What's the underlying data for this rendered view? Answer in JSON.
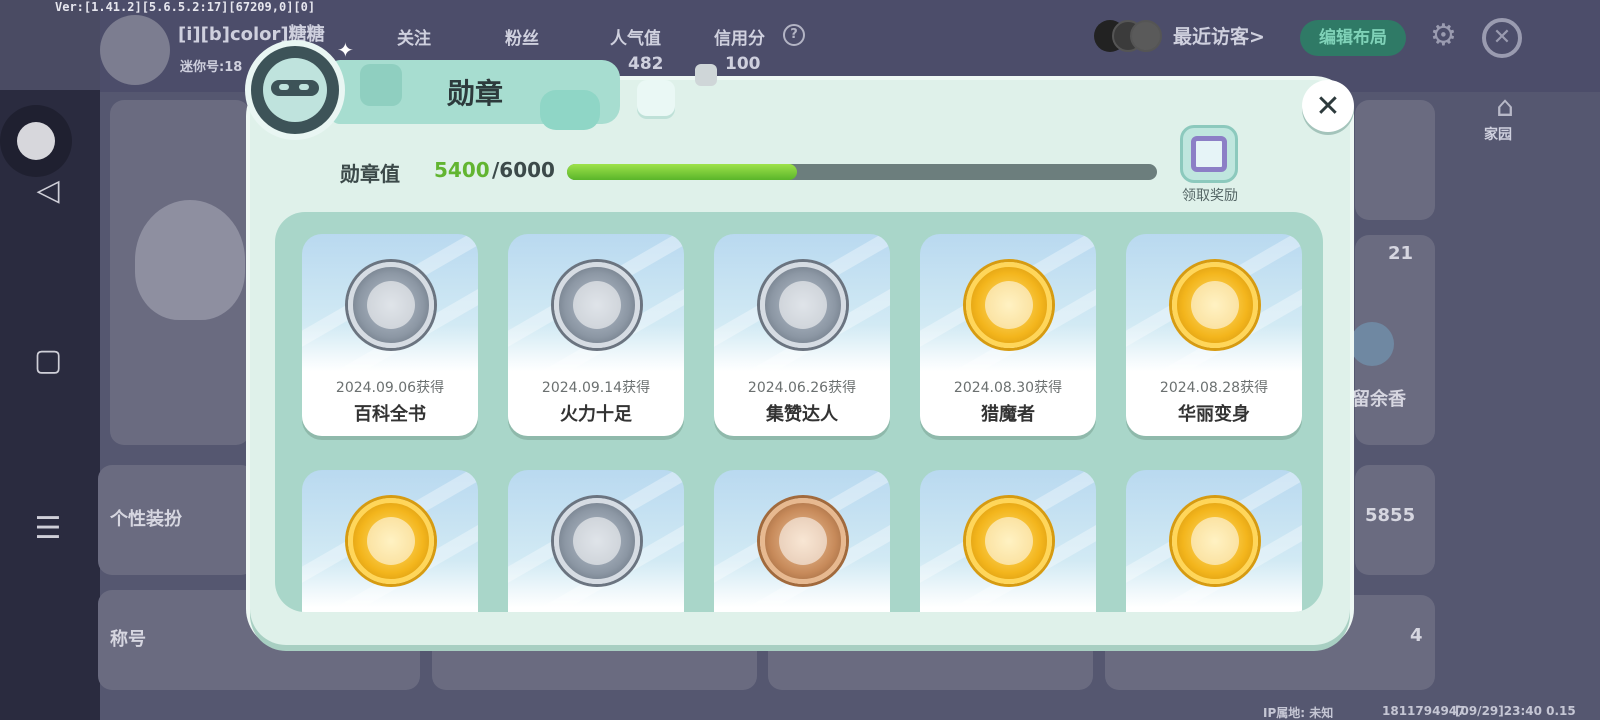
{
  "version_text": "Ver:[1.41.2][5.6.5.2:17][67209,0][0]",
  "profile": {
    "name": "[i][b]color]糖糖",
    "mini_id": "迷你号:18",
    "stats": [
      {
        "label": "关注",
        "value": ""
      },
      {
        "label": "粉丝",
        "value": ""
      },
      {
        "label": "人气值",
        "value": "482"
      },
      {
        "label": "信用分",
        "value": "100"
      }
    ],
    "help_icon": "question-icon"
  },
  "header_right": {
    "recent_visitors": "最近访客>",
    "edit_layout": "编辑布局",
    "home_label": "家园"
  },
  "background": {
    "count_21": "21",
    "count_5855": "5855",
    "count_4": "4",
    "personal_dress": "个性装扮",
    "title_label": "称号",
    "lingering_text": "留余香",
    "footer_id": "1811794947",
    "footer_time": "[09/29]23:40 0.15",
    "footer_left": "IP属地: 未知"
  },
  "dialog": {
    "title": "勋章",
    "meter_label": "勋章值",
    "meter_current": "5400",
    "meter_max": "/6000",
    "meter_progress": 0.39,
    "reward_label": "领取奖励",
    "close_icon": "close-icon"
  },
  "badges": [
    {
      "date": "2024.09.06获得",
      "name": "百科全书",
      "tier": "silver"
    },
    {
      "date": "2024.09.14获得",
      "name": "火力十足",
      "tier": "silver"
    },
    {
      "date": "2024.06.26获得",
      "name": "集赞达人",
      "tier": "silver"
    },
    {
      "date": "2024.08.30获得",
      "name": "猎魔者",
      "tier": "gold"
    },
    {
      "date": "2024.08.28获得",
      "name": "华丽变身",
      "tier": "gold"
    },
    {
      "date": "",
      "name": "",
      "tier": "gold"
    },
    {
      "date": "",
      "name": "",
      "tier": "silver"
    },
    {
      "date": "",
      "name": "",
      "tier": "bronze"
    },
    {
      "date": "",
      "name": "",
      "tier": "gold"
    },
    {
      "date": "",
      "name": "",
      "tier": "gold"
    }
  ]
}
